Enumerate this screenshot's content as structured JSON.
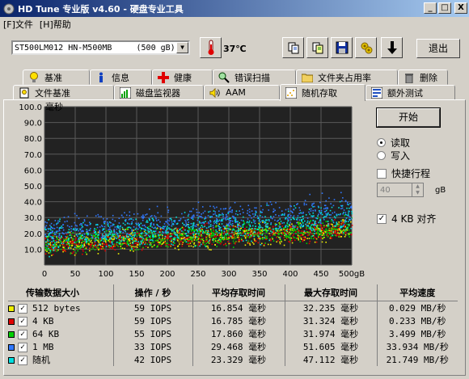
{
  "window": {
    "title": "HD Tune 专业版 v4.60 - 硬盘专业工具",
    "min_glyph": "_",
    "max_glyph": "□",
    "close_glyph": "X"
  },
  "menu": {
    "items": [
      "文件",
      "帮助"
    ],
    "file_accel": "F",
    "help_accel": "H"
  },
  "toolbar": {
    "drive": "ST500LM012 HN-M500MB     (500 gB)",
    "temperature": "37℃",
    "exit_label": "退出"
  },
  "tabs": {
    "row1": [
      "基准",
      "信息",
      "健康",
      "错误扫描",
      "文件夹占用率",
      "删除"
    ],
    "row2": [
      "文件基准",
      "磁盘监视器",
      "AAM",
      "随机存取",
      "额外测试"
    ],
    "active": "随机存取"
  },
  "controls": {
    "start_label": "开始",
    "read_label": "读取",
    "write_label": "写入",
    "quick_label": "快捷行程",
    "quick_value": "40",
    "quick_unit": "gB",
    "align_label": "4 KB 对齐",
    "read_selected": true,
    "quick_checked": false,
    "align_checked": true
  },
  "chart_data": {
    "type": "scatter",
    "ylabel": "毫秒",
    "x_unit_suffix": "gB",
    "xlim": [
      0,
      500
    ],
    "ylim": [
      0,
      100
    ],
    "x_ticks": [
      "0",
      "50",
      "100",
      "150",
      "200",
      "250",
      "300",
      "350",
      "400",
      "450",
      "500gB"
    ],
    "y_ticks": [
      "100.0",
      "90.0",
      "80.0",
      "70.0",
      "60.0",
      "50.0",
      "40.0",
      "30.0",
      "20.0",
      "10.0"
    ],
    "grid": true,
    "series": [
      {
        "name": "512 bytes",
        "color": "#f0f000",
        "trend": [
          [
            0,
            13
          ],
          [
            500,
            23
          ]
        ],
        "spread": 5
      },
      {
        "name": "4 KB",
        "color": "#e00000",
        "trend": [
          [
            0,
            13
          ],
          [
            500,
            23
          ]
        ],
        "spread": 5
      },
      {
        "name": "64 KB",
        "color": "#00d000",
        "trend": [
          [
            0,
            14
          ],
          [
            500,
            24
          ]
        ],
        "spread": 5
      },
      {
        "name": "1 MB",
        "color": "#3078ff",
        "trend": [
          [
            0,
            21
          ],
          [
            500,
            36
          ]
        ],
        "spread": 7
      },
      {
        "name": "随机",
        "color": "#00e0e0",
        "trend": [
          [
            0,
            17
          ],
          [
            500,
            30
          ]
        ],
        "spread": 7
      }
    ]
  },
  "stats": {
    "headers": [
      "传输数据大小",
      "操作 / 秒",
      "平均存取时间",
      "最大存取时间",
      "平均速度"
    ],
    "rows": [
      {
        "color": "#f0f000",
        "size": "512 bytes",
        "ops": "59 IOPS",
        "avg": "16.854 毫秒",
        "max": "32.235 毫秒",
        "speed": "0.029 MB/秒"
      },
      {
        "color": "#e00000",
        "size": "4 KB",
        "ops": "59 IOPS",
        "avg": "16.785 毫秒",
        "max": "31.324 毫秒",
        "speed": "0.233 MB/秒"
      },
      {
        "color": "#00d000",
        "size": "64 KB",
        "ops": "55 IOPS",
        "avg": "17.860 毫秒",
        "max": "31.974 毫秒",
        "speed": "3.499 MB/秒"
      },
      {
        "color": "#3078ff",
        "size": "1 MB",
        "ops": "33 IOPS",
        "avg": "29.468 毫秒",
        "max": "51.605 毫秒",
        "speed": "33.934 MB/秒"
      },
      {
        "color": "#00e0e0",
        "size": "随机",
        "ops": "42 IOPS",
        "avg": "23.329 毫秒",
        "max": "47.112 毫秒",
        "speed": "21.749 MB/秒"
      }
    ]
  },
  "icons": [
    "app-icon",
    "thermometer-icon",
    "copy-icon",
    "copy-all-icon",
    "save-icon",
    "options-icon",
    "download-icon"
  ]
}
